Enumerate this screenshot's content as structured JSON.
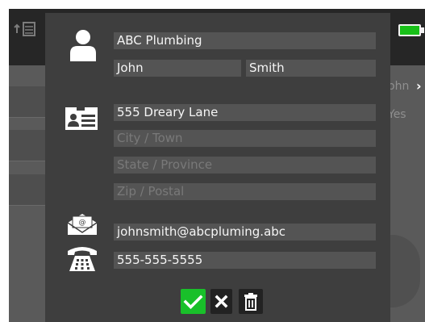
{
  "background": {
    "list_icon": "list-icon",
    "battery_color": "#18c018",
    "right_text_1": "ohn",
    "right_text_2": "Yes",
    "chevron": "›"
  },
  "contact": {
    "company": "ABC Plumbing",
    "first_name": "John",
    "last_name": "Smith",
    "address": "555 Dreary Lane",
    "city_placeholder": "City / Town",
    "state_placeholder": "State / Province",
    "zip_placeholder": "Zip / Postal",
    "email": "johnsmith@abcpluming.abc",
    "phone": "555-555-5555"
  },
  "icons": {
    "person": "person-icon",
    "address_card": "address-card-icon",
    "email": "email-envelope-icon",
    "phone": "telephone-icon"
  },
  "actions": {
    "confirm": "confirm-button",
    "cancel": "cancel-button",
    "delete": "delete-button",
    "confirm_color": "#19c02a"
  }
}
